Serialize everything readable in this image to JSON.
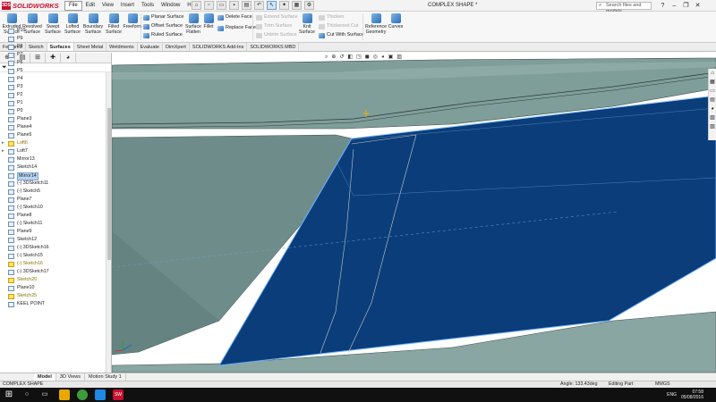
{
  "app": {
    "name": "SOLIDWORKS",
    "doc_title": "COMPLEX SHAPE *"
  },
  "menu": [
    "File",
    "Edit",
    "View",
    "Insert",
    "Tools",
    "Window",
    "Help"
  ],
  "search": {
    "placeholder": "Search files and models"
  },
  "ribbon": {
    "big_buttons": [
      {
        "label1": "Extruded",
        "label2": "Surface"
      },
      {
        "label1": "Revolved",
        "label2": "Surface"
      },
      {
        "label1": "Swept",
        "label2": "Surface"
      },
      {
        "label1": "Lofted",
        "label2": "Surface"
      },
      {
        "label1": "Boundary",
        "label2": "Surface"
      },
      {
        "label1": "Filled",
        "label2": "Surface"
      },
      {
        "label1": "Freeform",
        "label2": ""
      }
    ],
    "col1": [
      "Planar Surface",
      "Offset Surface",
      "Ruled Surface"
    ],
    "flatten": {
      "label1": "Surface",
      "label2": "Flatten"
    },
    "fillet": "Fillet",
    "col2": [
      "Delete Face",
      "Replace Face"
    ],
    "col3": [
      "Extend Surface",
      "Trim Surface",
      "Untrim Surface"
    ],
    "knit": {
      "label1": "Knit",
      "label2": "Surface"
    },
    "col4": [
      "Thicken",
      "Thickened Cut",
      "Cut With Surface"
    ],
    "refgeom": {
      "label1": "Reference",
      "label2": "Geometry"
    },
    "curves": "Curves"
  },
  "cmd_tabs": [
    "Features",
    "Sketch",
    "Surfaces",
    "Sheet Metal",
    "Weldments",
    "Evaluate",
    "DimXpert",
    "SOLIDWORKS Add-Ins",
    "SOLIDWORKS MBD"
  ],
  "tree": [
    {
      "label": "P10",
      "type": "plane"
    },
    {
      "label": "P9",
      "type": "plane"
    },
    {
      "label": "P8",
      "type": "plane"
    },
    {
      "label": "P7",
      "type": "plane"
    },
    {
      "label": "P6",
      "type": "plane"
    },
    {
      "label": "P5",
      "type": "plane"
    },
    {
      "label": "P4",
      "type": "plane"
    },
    {
      "label": "P3",
      "type": "plane"
    },
    {
      "label": "P2",
      "type": "plane"
    },
    {
      "label": "P1",
      "type": "plane"
    },
    {
      "label": "P0",
      "type": "plane"
    },
    {
      "label": "Plane3",
      "type": "plane"
    },
    {
      "label": "Plane4",
      "type": "plane"
    },
    {
      "label": "Plane5",
      "type": "plane"
    },
    {
      "label": "Loft6",
      "type": "warn",
      "expand": "▸"
    },
    {
      "label": "Loft7",
      "type": "feature",
      "expand": "▸"
    },
    {
      "label": "Mirror13",
      "type": "feature"
    },
    {
      "label": "Sketch14",
      "type": "sketch"
    },
    {
      "label": "Mirror14",
      "type": "feature",
      "selected": true
    },
    {
      "label": "(-) 3DSketch11",
      "type": "sketch"
    },
    {
      "label": "(-) Sketch5",
      "type": "sketch"
    },
    {
      "label": "Plane7",
      "type": "plane"
    },
    {
      "label": "(-) Sketch10",
      "type": "sketch"
    },
    {
      "label": "Plane8",
      "type": "plane"
    },
    {
      "label": "(-) Sketch11",
      "type": "sketch"
    },
    {
      "label": "Plane9",
      "type": "plane"
    },
    {
      "label": "Sketch12",
      "type": "sketch"
    },
    {
      "label": "(-) 3DSketch16",
      "type": "sketch"
    },
    {
      "label": "(-) Sketch15",
      "type": "sketch"
    },
    {
      "label": "(-) Sketch16",
      "type": "warn"
    },
    {
      "label": "(-) 3DSketch17",
      "type": "sketch"
    },
    {
      "label": "Sketch20",
      "type": "warn"
    },
    {
      "label": "Plane10",
      "type": "plane"
    },
    {
      "label": "Sketch25",
      "type": "warn"
    },
    {
      "label": "KEEL POINT",
      "type": "sketch"
    }
  ],
  "bottom_tabs": [
    "Model",
    "3D Views",
    "Motion Study 1"
  ],
  "status": {
    "left": "COMPLEX SHAPE",
    "angle": "Angle: 133.43deg",
    "mode": "Editing Part",
    "units": "MMGS"
  },
  "tray": {
    "lang": "ENG",
    "time": "07:58",
    "date": "05/08/2016"
  },
  "colors": {
    "selected_face": "#0a3d7a",
    "hull": "#7a9f9b",
    "accent": "#c8102e"
  }
}
